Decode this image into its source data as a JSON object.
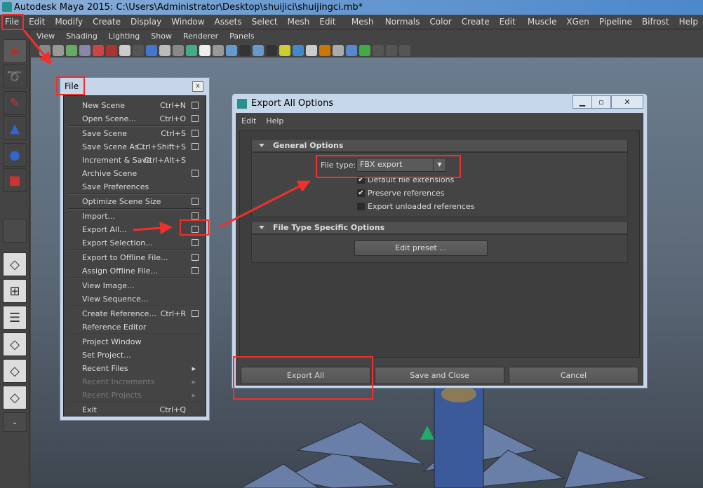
{
  "window": {
    "title": "Autodesk Maya 2015: C:\\Users\\Administrator\\Desktop\\shuijici\\shuijingci.mb*"
  },
  "menubar": [
    "File",
    "Edit",
    "Modify",
    "Create",
    "Display",
    "Window",
    "Assets",
    "Select",
    "Mesh",
    "Edit Mesh",
    "Mesh Tools",
    "Normals",
    "Color",
    "Create UVs",
    "Edit UVs",
    "Muscle",
    "XGen",
    "Pipeline Cache",
    "Bifrost",
    "Help"
  ],
  "viewport_menu": [
    "View",
    "Shading",
    "Lighting",
    "Show",
    "Renderer",
    "Panels"
  ],
  "file_menu": {
    "title": "File",
    "close": "x",
    "items": [
      {
        "label": "New Scene",
        "shortcut": "Ctrl+N",
        "option": true
      },
      {
        "label": "Open Scene...",
        "shortcut": "Ctrl+O",
        "option": true
      },
      {
        "sep": true
      },
      {
        "label": "Save Scene",
        "shortcut": "Ctrl+S",
        "option": true
      },
      {
        "label": "Save Scene As...",
        "shortcut": "Ctrl+Shift+S",
        "option": true
      },
      {
        "label": "Increment & Save",
        "shortcut": "Ctrl+Alt+S"
      },
      {
        "label": "Archive Scene",
        "option": true
      },
      {
        "label": "Save Preferences"
      },
      {
        "sep": true
      },
      {
        "label": "Optimize Scene Size",
        "option": true
      },
      {
        "sep": true
      },
      {
        "label": "Import...",
        "option": true
      },
      {
        "label": "Export All...",
        "option": true
      },
      {
        "label": "Export Selection...",
        "option": true
      },
      {
        "sep": true
      },
      {
        "label": "Export to Offline File...",
        "option": true
      },
      {
        "label": "Assign Offline File...",
        "option": true
      },
      {
        "sep": true
      },
      {
        "label": "View Image..."
      },
      {
        "label": "View Sequence..."
      },
      {
        "sep": true
      },
      {
        "label": "Create Reference...",
        "shortcut": "Ctrl+R",
        "option": true
      },
      {
        "label": "Reference Editor"
      },
      {
        "sep": true
      },
      {
        "label": "Project Window"
      },
      {
        "label": "Set Project..."
      },
      {
        "label": "Recent Files",
        "submenu": true
      },
      {
        "label": "Recent Increments",
        "submenu": true,
        "disabled": true
      },
      {
        "label": "Recent Projects",
        "submenu": true,
        "disabled": true
      },
      {
        "sep": true
      },
      {
        "label": "Exit",
        "shortcut": "Ctrl+Q"
      }
    ]
  },
  "dialog": {
    "title": "Export All Options",
    "menu": [
      "Edit",
      "Help"
    ],
    "general_options": {
      "header": "General Options",
      "file_type_label": "File type:",
      "file_type_value": "FBX export",
      "checkboxes": [
        {
          "label": "Default file extensions",
          "checked": true
        },
        {
          "label": "Preserve references",
          "checked": true
        },
        {
          "label": "Export unloaded references",
          "checked": false
        }
      ]
    },
    "specific_options": {
      "header": "File Type Specific Options",
      "edit_preset": "Edit preset ..."
    },
    "buttons": {
      "export_all": "Export All",
      "save_close": "Save and Close",
      "cancel": "Cancel"
    }
  },
  "colors": {
    "annotation": "#f0302c",
    "ui_bg": "#444444",
    "title_blue": "#4c88cc"
  }
}
